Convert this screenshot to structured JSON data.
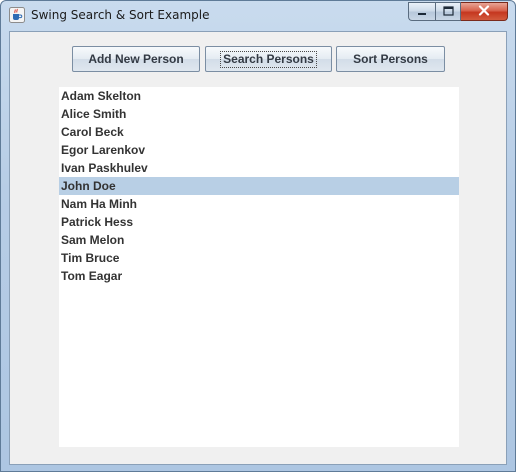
{
  "window": {
    "title": "Swing Search & Sort Example",
    "icon": "java-coffee-cup-icon"
  },
  "caption_buttons": {
    "minimize_icon": "minimize-icon",
    "maximize_icon": "maximize-icon",
    "close_icon": "close-icon"
  },
  "toolbar": {
    "add_label": "Add New Person",
    "search_label": "Search Persons",
    "sort_label": "Sort Persons"
  },
  "list": {
    "items": [
      "Adam Skelton",
      "Alice Smith",
      "Carol Beck",
      "Egor Larenkov",
      "Ivan Paskhulev",
      "John Doe",
      "Nam Ha Minh",
      "Patrick Hess",
      "Sam Melon",
      "Tim Bruce",
      "Tom Eagar"
    ],
    "selected": "John Doe"
  },
  "colors": {
    "selection": "#b8cfe5",
    "panel": "#f0f0f0",
    "frame": "#b7cde6",
    "close_button": "#c5371f"
  }
}
